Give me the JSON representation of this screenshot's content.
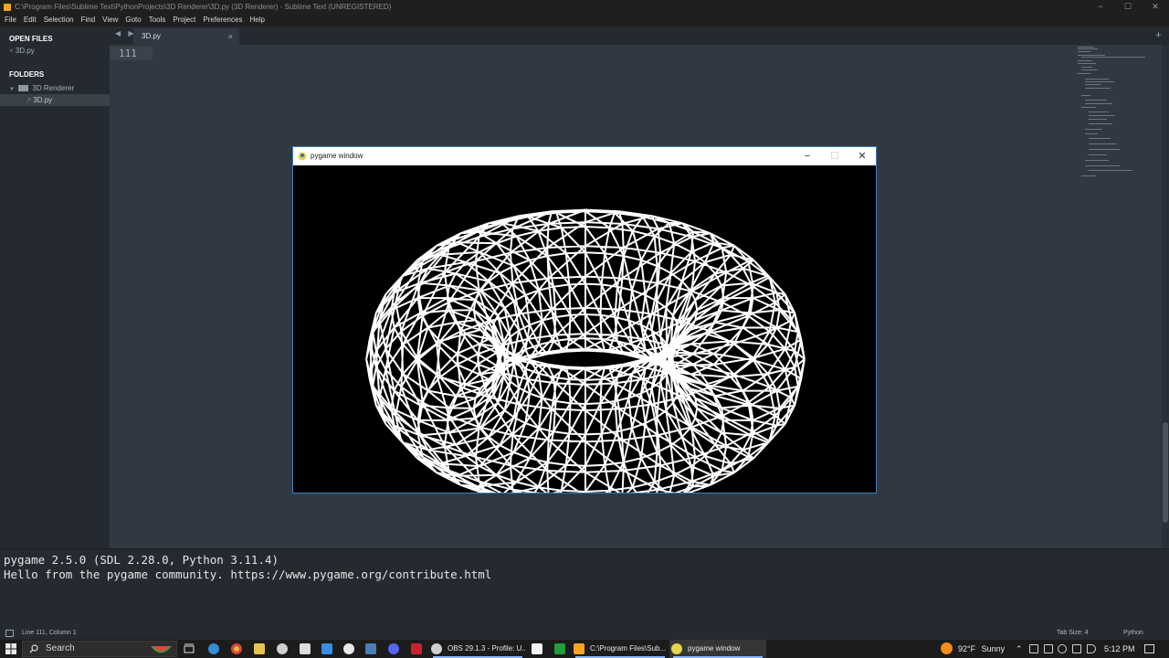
{
  "window": {
    "title": "C:\\Program Files\\Sublime Text\\PythonProjects\\3D Renderer\\3D.py (3D Renderer) - Sublime Text (UNREGISTERED)",
    "controls": {
      "minimize": "−",
      "maximize": "☐",
      "close": "✕"
    }
  },
  "menu": [
    "File",
    "Edit",
    "Selection",
    "Find",
    "View",
    "Goto",
    "Tools",
    "Project",
    "Preferences",
    "Help"
  ],
  "sidebar": {
    "open_files_heading": "OPEN FILES",
    "open_files": [
      {
        "close": "×",
        "label": "3D.py"
      }
    ],
    "folders_heading": "FOLDERS",
    "folder": {
      "name": "3D Renderer",
      "children": [
        {
          "label": "3D.py",
          "prefix": "/*"
        }
      ]
    }
  },
  "tabs": [
    {
      "label": "3D.py",
      "close": "×"
    }
  ],
  "tab_nav": "◀ ▶",
  "new_tab": "+",
  "editor": {
    "line_number": "111"
  },
  "console": {
    "lines": [
      "pygame 2.5.0 (SDL 2.28.0, Python 3.11.4)",
      "Hello from the pygame community. https://www.pygame.org/contribute.html"
    ]
  },
  "status": {
    "position": "Line 111, Column 1",
    "tab_size": "Tab Size: 4",
    "syntax": "Python"
  },
  "pygame_window": {
    "title": "pygame window",
    "controls": {
      "minimize": "−",
      "maximize": "☐",
      "close": "✕"
    }
  },
  "taskbar": {
    "search_label": "Search",
    "apps": [
      {
        "label": "OBS 29.1.3 - Profile: U...",
        "color": "#cfcfcf"
      },
      {
        "label": "C:\\Program Files\\Sub...",
        "color": "#f5a623"
      },
      {
        "label": "pygame window",
        "color": "#e6d44a",
        "active": true
      }
    ],
    "weather": {
      "temp": "92°F",
      "condition": "Sunny"
    },
    "time": "5:12 PM"
  },
  "colors": {
    "editor_bg": "#303841",
    "sidebar_bg": "#252a30",
    "accent": "#3f7fbf"
  }
}
